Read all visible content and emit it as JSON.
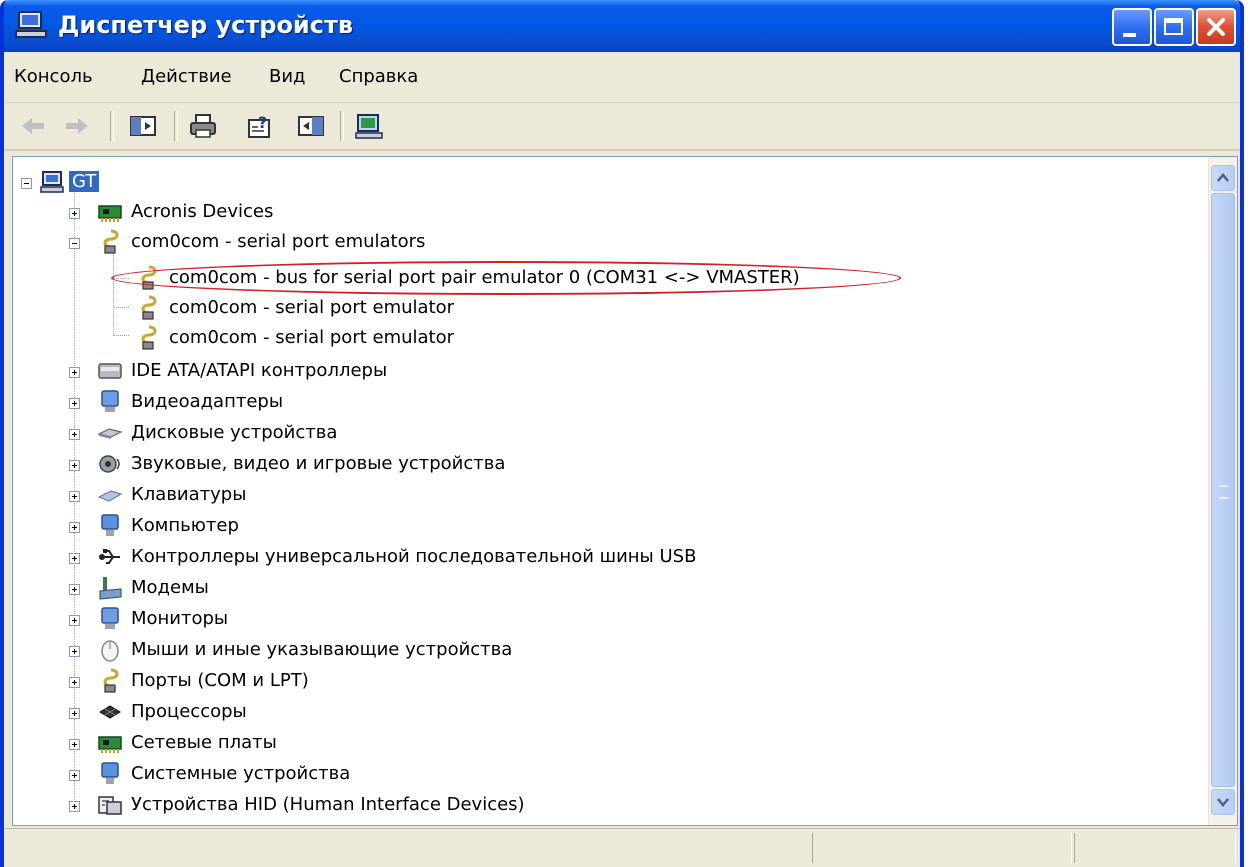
{
  "window": {
    "title": "Диспетчер устройств",
    "title_icon": "device-manager-icon"
  },
  "titlebar_buttons": [
    "minimize-icon",
    "maximize-icon",
    "close-icon"
  ],
  "menu": {
    "console": "Консоль",
    "action": "Действие",
    "view": "Вид",
    "help": "Справка"
  },
  "toolbar": [
    "back-arrow-icon",
    "forward-arrow-icon",
    "show-hide-console-tree-icon",
    "print-icon",
    "properties-help-icon",
    "update-driver-icon",
    "scan-hardware-icon"
  ],
  "tree": {
    "root": "GT",
    "acronis": "Acronis Devices",
    "com0com": "com0com - serial port emulators",
    "com0com_bus": "com0com - bus for serial port pair emulator 0 (COM31 <-> VMASTER)",
    "com0com_port_a": "com0com - serial port emulator",
    "com0com_port_b": "com0com - serial port emulator",
    "ide": "IDE ATA/ATAPI контроллеры",
    "video": "Видеоадаптеры",
    "disk": "Дисковые устройства",
    "sound": "Звуковые, видео и игровые устройства",
    "keyboard": "Клавиатуры",
    "computer": "Компьютер",
    "usb": "Контроллеры универсальной последовательной шины USB",
    "modems": "Модемы",
    "monitors": "Мониторы",
    "mice": "Мыши и иные указывающие устройства",
    "ports": "Порты (COM и LPT)",
    "cpu": "Процессоры",
    "network": "Сетевые платы",
    "system": "Системные устройства",
    "hid": "Устройства HID (Human Interface Devices)"
  },
  "colors": {
    "titlebar": "#0058e6",
    "selection": "#316ac5",
    "annotation": "#c8242a",
    "window_bg": "#ece9d8"
  }
}
